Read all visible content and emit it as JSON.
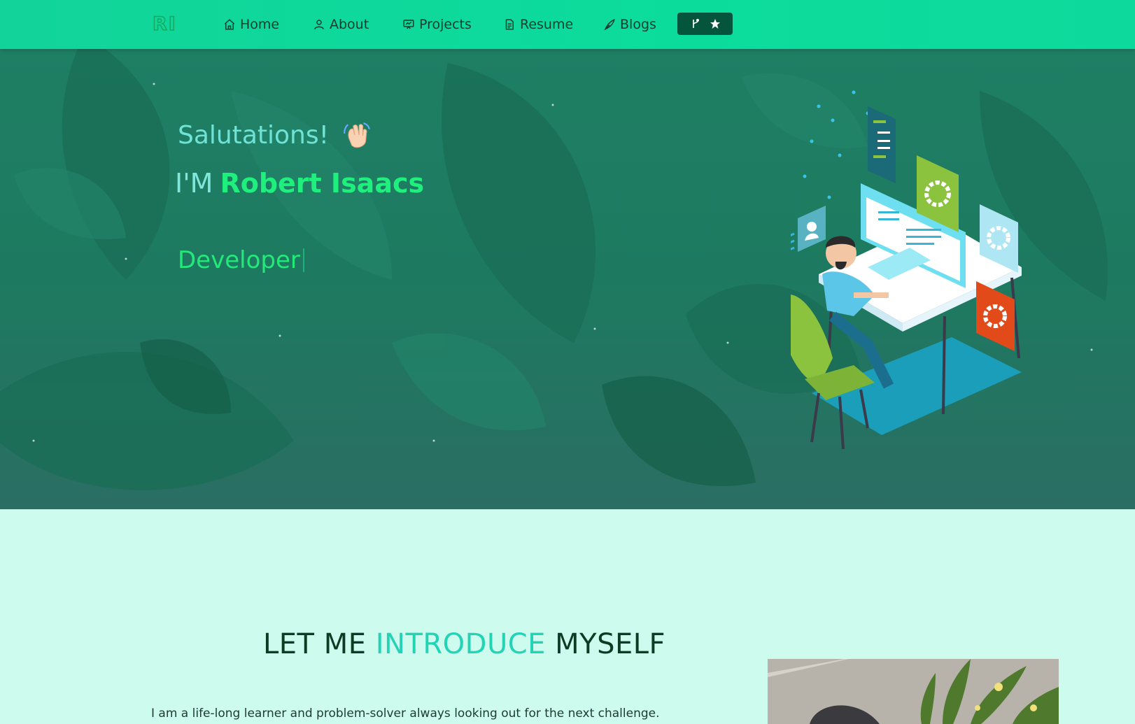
{
  "nav": {
    "logo_text": "RI",
    "items": [
      {
        "label": "Home",
        "icon": "home-icon"
      },
      {
        "label": "About",
        "icon": "user-icon"
      },
      {
        "label": "Projects",
        "icon": "projects-icon"
      },
      {
        "label": "Resume",
        "icon": "document-icon"
      },
      {
        "label": "Blogs",
        "icon": "blog-icon"
      }
    ],
    "github_button": {
      "icons": [
        "fork-icon",
        "star-icon"
      ]
    }
  },
  "hero": {
    "greeting": "Salutations!",
    "intro_prefix": "I'M",
    "name": "Robert Isaacs",
    "typed_text": "Developer"
  },
  "about": {
    "title_start": "LET ME",
    "title_accent": "INTRODUCE",
    "title_end": "MYSELF",
    "paragraph": "I am a life-long learner and problem-solver always looking out for the next challenge."
  },
  "colors": {
    "navbar": "#0bdc9c",
    "accent_green": "#1ff07d",
    "accent_teal": "#22d3b6",
    "page_background": "#cdfbee"
  }
}
